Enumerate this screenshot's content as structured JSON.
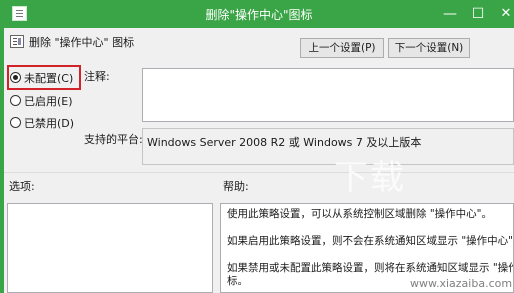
{
  "window": {
    "title": "删除\"操作中心\"图标",
    "minimize_glyph": "—",
    "maximize_glyph": "☐",
    "close_glyph": "✕",
    "titlebar_color": "#3aa546"
  },
  "header": {
    "policy_name": "删除 \"操作中心\" 图标",
    "prev_button": "上一个设置(P)",
    "next_button": "下一个设置(N)"
  },
  "options": {
    "not_configured": "未配置(C)",
    "enabled": "已启用(E)",
    "disabled": "已禁用(D)",
    "selected": "not_configured"
  },
  "fields": {
    "comment_label": "注释:",
    "comment_value": "",
    "platform_label": "支持的平台:",
    "platform_value": "Windows Server 2008 R2 或 Windows 7 及以上版本"
  },
  "sections": {
    "options_label": "选项:",
    "help_label": "帮助:"
  },
  "help": {
    "p1": "使用此策略设置，可以从系统控制区域删除 \"操作中心\"。",
    "p2": "如果启用此策略设置，则不会在系统通知区域显示 \"操作中心\" 图标。",
    "p3a": "如果禁用或未配置此策略设置，则将在系统通知区域显示 \"操作中心\"",
    "p3b": "标。"
  },
  "watermark": {
    "brand": "下载",
    "site": "www.xiazaiba.com"
  },
  "icons": {
    "app": "policy-icon",
    "page": "policy-page-icon"
  },
  "colors": {
    "highlight": "#d0232a"
  }
}
